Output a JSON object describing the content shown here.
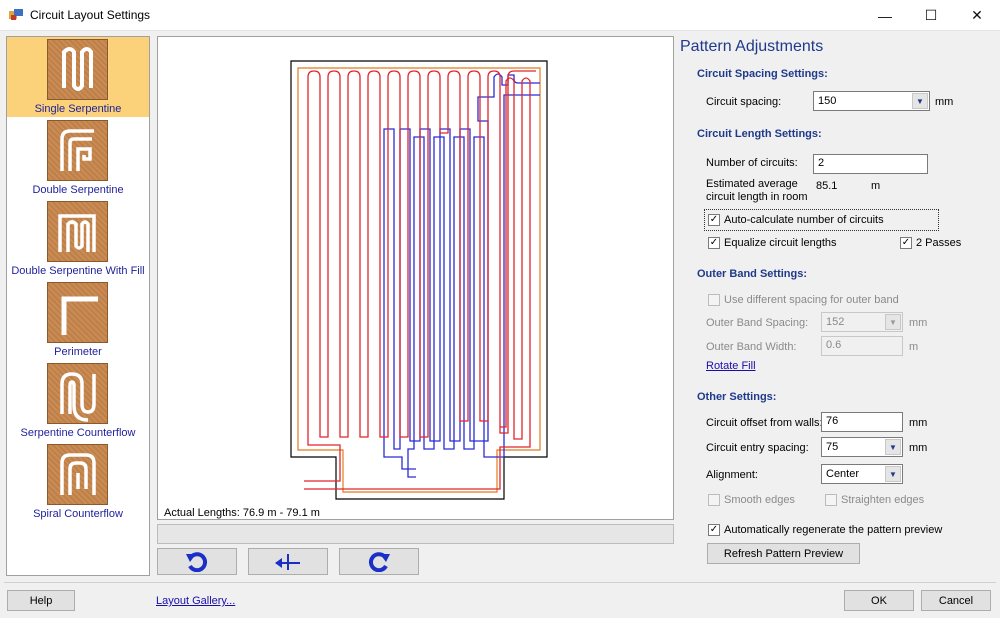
{
  "window": {
    "title": "Circuit Layout Settings",
    "minimize": "—",
    "maximize": "☐",
    "close": "✕"
  },
  "gallery": {
    "items": [
      {
        "label": "Single Serpentine",
        "selected": true,
        "icon": "single-serpentine-icon"
      },
      {
        "label": "Double Serpentine",
        "selected": false,
        "icon": "double-serpentine-icon"
      },
      {
        "label": "Double Serpentine With Fill",
        "selected": false,
        "icon": "double-serpentine-fill-icon"
      },
      {
        "label": "Perimeter",
        "selected": false,
        "icon": "perimeter-icon"
      },
      {
        "label": "Serpentine Counterflow",
        "selected": false,
        "icon": "serpentine-counterflow-icon"
      },
      {
        "label": "Spiral Counterflow",
        "selected": false,
        "icon": "spiral-counterflow-icon"
      }
    ]
  },
  "preview": {
    "actual_lengths": "Actual Lengths: 76.9 m - 79.1 m",
    "circuit_colors": [
      "#e0262a",
      "#2b2bd8"
    ],
    "outer_band_color": "#e07b1e"
  },
  "toolbar": {
    "rotate_left_icon": "rotate-left-icon",
    "mirror_icon": "mirror-icon",
    "rotate_right_icon": "rotate-right-icon"
  },
  "panel": {
    "title": "Pattern Adjustments",
    "spacing": {
      "heading": "Circuit Spacing Settings:",
      "label": "Circuit spacing:",
      "value": "150",
      "unit": "mm"
    },
    "length": {
      "heading": "Circuit Length Settings:",
      "num_label": "Number of circuits:",
      "num_value": "2",
      "est_label_1": "Estimated average",
      "est_label_2": "circuit length in room",
      "est_value": "85.1",
      "est_unit": "m",
      "auto_calc": {
        "label": "Auto-calculate number of circuits",
        "checked": true
      },
      "equalize": {
        "label": "Equalize circuit lengths",
        "checked": true
      },
      "two_passes": {
        "label": "2 Passes",
        "checked": true
      }
    },
    "outer_band": {
      "heading": "Outer Band Settings:",
      "use_diff": {
        "label": "Use different spacing for outer band",
        "checked": false
      },
      "spacing_label": "Outer Band Spacing:",
      "spacing_value": "152",
      "spacing_unit": "mm",
      "width_label": "Outer Band Width:",
      "width_value": "0.6",
      "width_unit": "m",
      "rotate_fill": "Rotate Fill"
    },
    "other": {
      "heading": "Other Settings:",
      "offset_label": "Circuit offset from walls:",
      "offset_value": "76",
      "offset_unit": "mm",
      "entry_label": "Circuit entry spacing:",
      "entry_value": "75",
      "entry_unit": "mm",
      "align_label": "Alignment:",
      "align_value": "Center",
      "smooth": {
        "label": "Smooth edges",
        "checked": false
      },
      "straighten": {
        "label": "Straighten edges",
        "checked": false
      }
    },
    "auto_regen": {
      "label": "Automatically regenerate the pattern preview",
      "checked": true
    },
    "refresh_button": "Refresh Pattern Preview"
  },
  "footer": {
    "help": "Help",
    "gallery_link": "Layout Gallery...",
    "ok": "OK",
    "cancel": "Cancel"
  }
}
